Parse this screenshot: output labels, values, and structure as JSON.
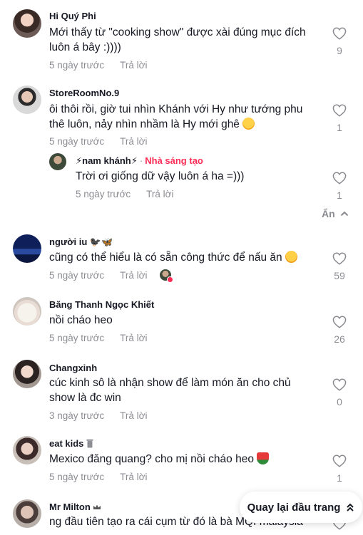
{
  "comments": [
    {
      "username": "Hi Quý Phi",
      "text": "Mới thấy từ \"cooking show\" được xài đúng mục đích luôn á bây :))))",
      "time": "5 ngày trước",
      "reply": "Trả lời",
      "likes": "9"
    },
    {
      "username": "StoreRoomNo.9",
      "text": "ôi thôi rồi, giờ tui nhìn Khánh với Hy như tướng phu thê luôn, nảy nhìn nhầm là Hy mới ghê",
      "time": "5 ngày trước",
      "reply": "Trả lời",
      "likes": "1",
      "replies": [
        {
          "username": "⚡nam khánh⚡",
          "creator_label": "Nhà sáng tạo",
          "text": "Trời ơi giống dữ vậy luôn á ha =)))",
          "time": "5 ngày trước",
          "reply": "Trả lời",
          "likes": "1"
        }
      ],
      "hide_label": "Ẩn"
    },
    {
      "username": "người iu 🐦‍⬛🦋",
      "text": "cũng có thể hiểu là có sẵn công thức để nấu ăn",
      "time": "5 ngày trước",
      "reply": "Trả lời",
      "likes": "59"
    },
    {
      "username": "Băng Thanh Ngọc Khiết",
      "text": "nồi cháo heo",
      "time": "5 ngày trước",
      "reply": "Trả lời",
      "likes": "26"
    },
    {
      "username": "Changxinh",
      "text": "cúc kinh sô là nhận show để làm món ăn cho chủ show là đc win",
      "time": "3 ngày trước",
      "reply": "Trả lời",
      "likes": "0"
    },
    {
      "username": "eat kids",
      "text": "Mexico đăng quang? cho mị nồi cháo heo",
      "time": "5 ngày trước",
      "reply": "Trả lời",
      "likes": "1"
    },
    {
      "username": "Mr Milton",
      "text": "ng đầu tiên tạo ra cái cụm từ đó là bà MQI malaysia",
      "time": "",
      "reply": "",
      "likes": ""
    }
  ],
  "back_to_top": "Quay lại đầu trang",
  "colors": {
    "text": "#161823",
    "muted": "rgba(22,24,35,0.5)",
    "creator": "#fe2c55"
  },
  "icons": {
    "like": "heart-outline-icon",
    "collapse": "chevron-up-icon",
    "back_to_top": "double-chevron-up-icon"
  }
}
